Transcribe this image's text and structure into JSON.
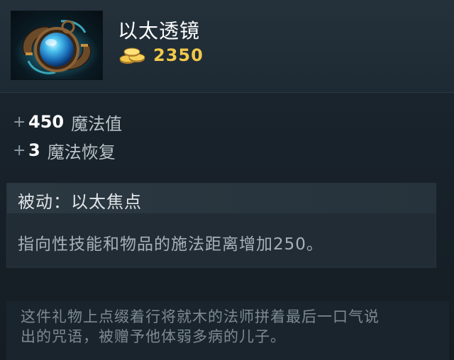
{
  "item": {
    "name": "以太透镜",
    "cost": "2350",
    "icon": "aether-lens-icon"
  },
  "stats": [
    {
      "plus": "+",
      "value": "450",
      "label": "魔法值"
    },
    {
      "plus": "+",
      "value": "3",
      "label": "魔法恢复"
    }
  ],
  "ability": {
    "title": "被动：以太焦点",
    "description": "指向性技能和物品的施法距离增加250。"
  },
  "lore": {
    "line1": "这件礼物上点缀着行将就木的法师拼着最后一口气说",
    "line2": "出的咒语，被赠予他体弱多病的儿子。"
  },
  "colors": {
    "gold": "#f2c84a",
    "name": "#ffffff",
    "background": "#1a232b"
  }
}
